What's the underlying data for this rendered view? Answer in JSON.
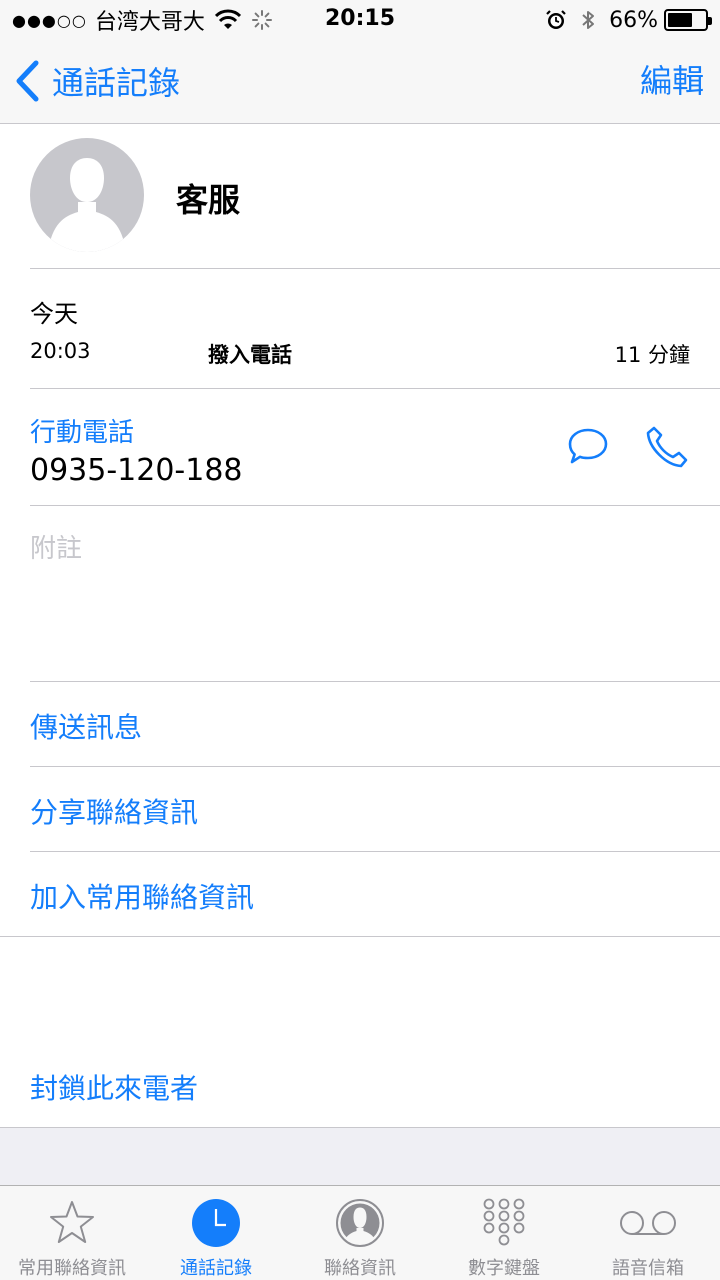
{
  "status_bar": {
    "signal_dots": "●●●○○",
    "carrier": "台湾大哥大",
    "time": "20:15",
    "battery_text": "66%",
    "battery_level": 0.66
  },
  "nav": {
    "back_label": "通話記錄",
    "edit_label": "編輯"
  },
  "contact": {
    "name": "客服"
  },
  "recent_call": {
    "day": "今天",
    "time": "20:03",
    "type": "撥入電話",
    "duration": "11 分鐘"
  },
  "phone": {
    "label": "行動電話",
    "number": "0935-120-188"
  },
  "notes": {
    "label": "附註"
  },
  "actions": {
    "send_message": "傳送訊息",
    "share_contact": "分享聯絡資訊",
    "add_favorite": "加入常用聯絡資訊",
    "block_caller": "封鎖此來電者"
  },
  "tabs": [
    {
      "label": "常用聯絡資訊",
      "icon": "star-icon"
    },
    {
      "label": "通話記錄",
      "icon": "clock-icon",
      "active": true
    },
    {
      "label": "聯絡資訊",
      "icon": "contact-icon"
    },
    {
      "label": "數字鍵盤",
      "icon": "keypad-icon"
    },
    {
      "label": "語音信箱",
      "icon": "voicemail-icon"
    }
  ],
  "colors": {
    "accent": "#147efb",
    "placeholder": "#c7c7cc",
    "tab_inactive": "#8e8e93"
  }
}
